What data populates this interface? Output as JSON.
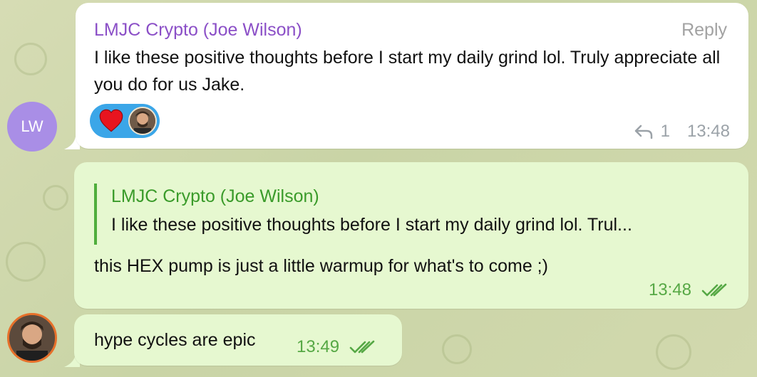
{
  "messages": {
    "incoming": {
      "avatar_initials": "LW",
      "sender": "LMJC Crypto (Joe Wilson)",
      "reply_label": "Reply",
      "text": "I like these positive thoughts before I start my daily grind lol. Truly appreciate all you do for us Jake.",
      "reaction_icon": "heart-icon",
      "reply_count": "1",
      "time": "13:48"
    },
    "outgoing_reply": {
      "quoted_sender": "LMJC Crypto (Joe Wilson)",
      "quoted_text": "I like these positive thoughts before I start my daily grind lol. Trul...",
      "text": "this HEX pump is just a little warmup for what's to come ;)",
      "time": "13:48",
      "status_icon": "double-check-icon"
    },
    "outgoing_short": {
      "text": "hype cycles are epic",
      "time": "13:49",
      "status_icon": "double-check-icon"
    }
  },
  "colors": {
    "incoming_sender": "#8b4fc7",
    "outgoing_accent": "#4fae3c",
    "outgoing_bubble": "#e6f8d0",
    "reaction_pill": "#3ba6e8",
    "avatar_lw": "#a98ee6"
  }
}
